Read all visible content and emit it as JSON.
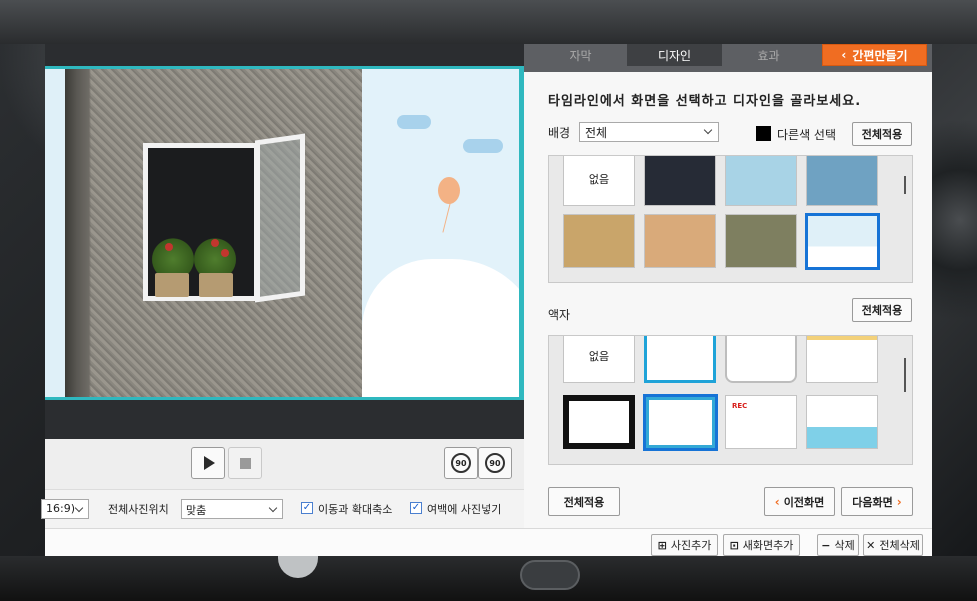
{
  "tabs": [
    {
      "label": "자막",
      "active": false
    },
    {
      "label": "디자인",
      "active": true
    },
    {
      "label": "효과",
      "active": false
    }
  ],
  "quick_make": {
    "label": "간편만들기",
    "icon": "chevron-left-icon"
  },
  "instruction": "타임라인에서 화면을 선택하고 디자인을 골라보세요.",
  "background": {
    "label": "배경",
    "select_value": "전체",
    "other_color_label": "다른색 선택",
    "apply_all_label": "전체적용",
    "thumbnails": [
      {
        "label": "없음",
        "selected": false
      },
      {
        "label": "",
        "style": "dark-navy",
        "selected": false
      },
      {
        "label": "",
        "style": "light-blue",
        "selected": false
      },
      {
        "label": "",
        "style": "steel-blue",
        "selected": false
      },
      {
        "label": "",
        "style": "old-map",
        "selected": false
      },
      {
        "label": "",
        "style": "tan",
        "selected": false
      },
      {
        "label": "",
        "style": "olive",
        "selected": false
      },
      {
        "label": "",
        "style": "sky-cloud",
        "selected": true
      }
    ]
  },
  "frame": {
    "label": "액자",
    "apply_all_label": "전체적용",
    "thumbnails": [
      {
        "label": "없음",
        "selected": false
      },
      {
        "label": "",
        "style": "blue-border",
        "selected": false
      },
      {
        "label": "",
        "style": "rounded",
        "selected": false
      },
      {
        "label": "",
        "style": "bunting",
        "selected": false
      },
      {
        "label": "",
        "style": "film",
        "selected": false
      },
      {
        "label": "",
        "style": "blue-double",
        "selected": true
      },
      {
        "label": "REC",
        "style": "rec",
        "selected": false
      },
      {
        "label": "",
        "style": "whale",
        "selected": false
      }
    ]
  },
  "footer": {
    "apply_all_label": "전체적용",
    "prev_label": "이전화면",
    "next_label": "다음화면"
  },
  "options": {
    "ratio_value": "16:9)",
    "photo_position_label": "전체사진위치",
    "photo_position_value": "맞춤",
    "move_zoom_label": "이동과 확대축소",
    "move_zoom_checked": true,
    "fill_margin_label": "여백에 사진넣기",
    "fill_margin_checked": true
  },
  "playback": {
    "rotate_left_label": "90",
    "rotate_right_label": "90"
  },
  "bottombar": {
    "add_photo": "사진추가",
    "add_scene": "새화면추가",
    "delete": "삭제",
    "delete_all": "전체삭제"
  },
  "colors": {
    "accent": "#f06d22",
    "frame_teal": "#2fb8bf",
    "selected_blue": "#1673d6",
    "tab_bar": "#5d5f63"
  }
}
